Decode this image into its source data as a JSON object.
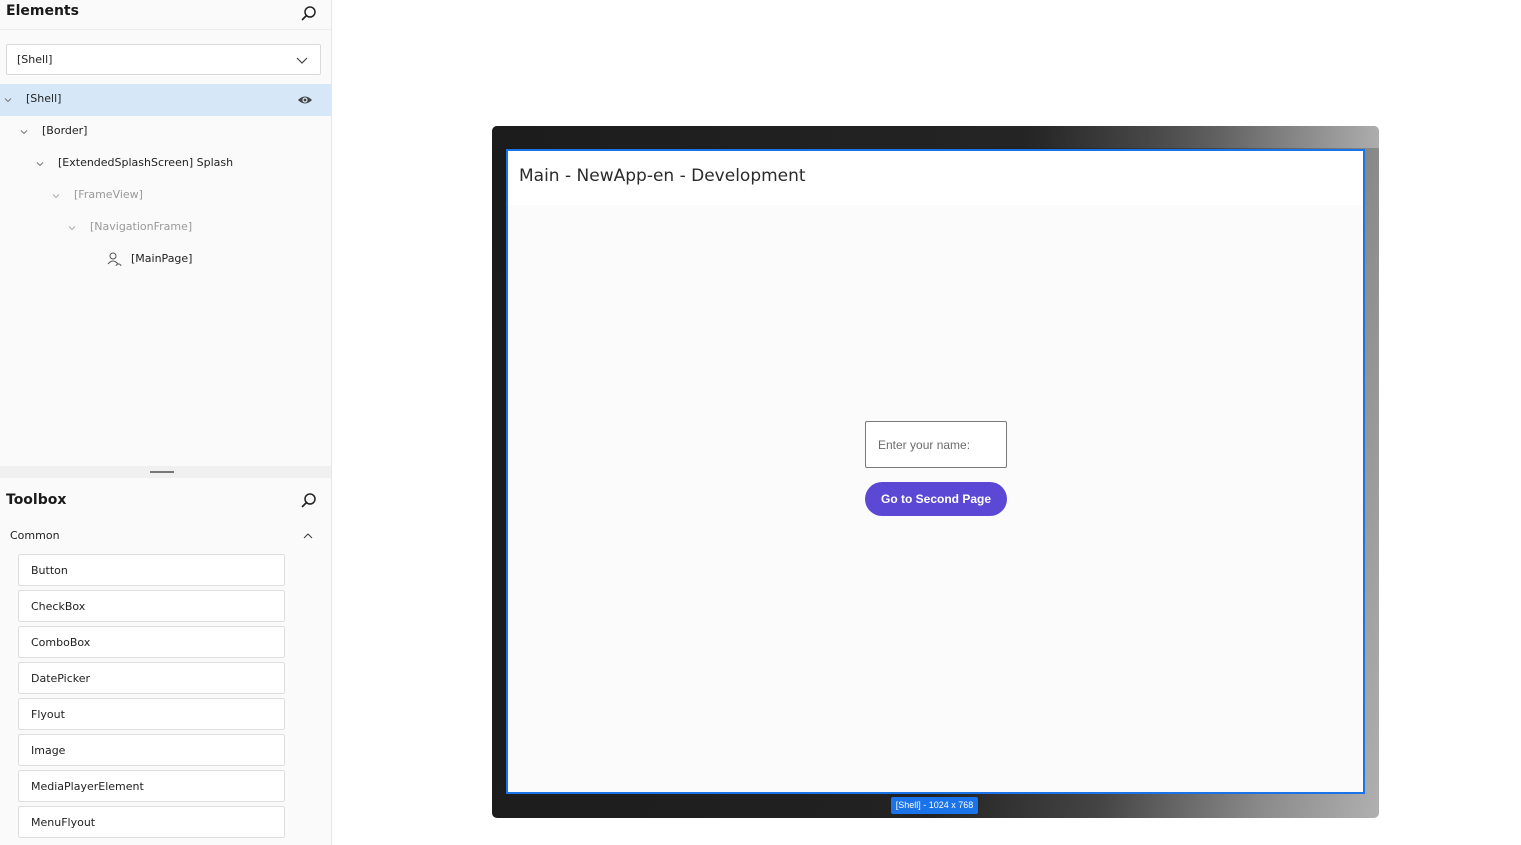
{
  "elements_panel": {
    "title": "Elements",
    "scope_value": "[Shell]",
    "tree": [
      {
        "label": "[Shell]",
        "selected": true,
        "dim": false
      },
      {
        "label": "[Border]",
        "selected": false,
        "dim": false
      },
      {
        "label": "[ExtendedSplashScreen] Splash",
        "selected": false,
        "dim": false
      },
      {
        "label": "[FrameView]",
        "selected": false,
        "dim": true
      },
      {
        "label": "[NavigationFrame]",
        "selected": false,
        "dim": true
      },
      {
        "label": "[MainPage]",
        "selected": false,
        "dim": false
      }
    ]
  },
  "toolbox": {
    "title": "Toolbox",
    "category": "Common",
    "items": [
      "Button",
      "CheckBox",
      "ComboBox",
      "DatePicker",
      "Flyout",
      "Image",
      "MediaPlayerElement",
      "MenuFlyout"
    ]
  },
  "preview": {
    "app_title": "Main - NewApp-en - Development",
    "name_placeholder": "Enter your name:",
    "button_label": "Go to Second Page",
    "size_badge": "[Shell] - 1024 x 768"
  },
  "colors": {
    "accent": "#1a73e8",
    "button": "#5b49d6",
    "selection": "#d6e8f8"
  },
  "icons": [
    "search-icon",
    "chevron-down-icon",
    "eye-icon",
    "page-user-icon",
    "chevron-up-icon"
  ]
}
